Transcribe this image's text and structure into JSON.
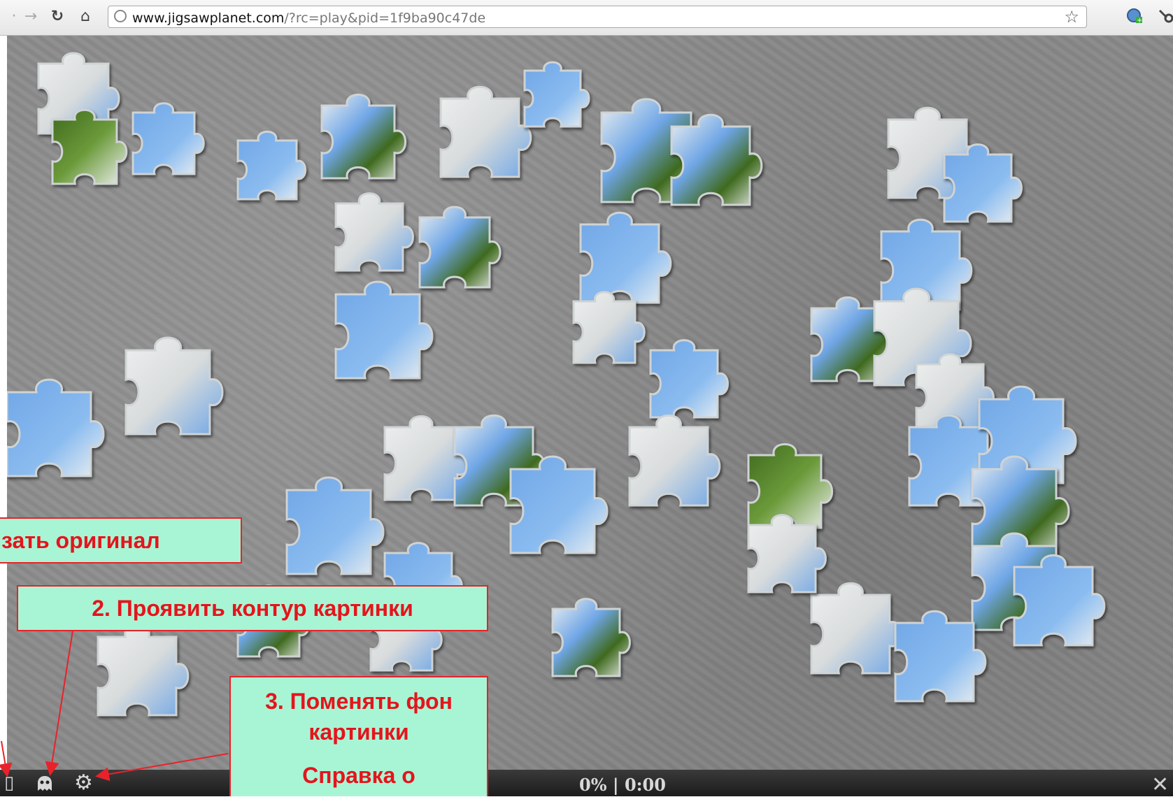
{
  "browser": {
    "url_domain": "www.jigsawplanet.com",
    "url_path": "/?rc=play&pid=1f9ba90c47de",
    "back_icon": "back-arrow-icon",
    "forward_icon": "forward-arrow-icon",
    "reload_icon": "reload-icon",
    "home_icon": "home-icon",
    "bookmark_icon": "star-icon"
  },
  "game": {
    "progress_text": "0% | 0:00",
    "progress_percent": 0,
    "elapsed": "0:00"
  },
  "callouts": {
    "show_original": "зать оригинал",
    "show_outline": "2. Проявить контур картинки",
    "change_bg_line1": "3. Поменять фон",
    "change_bg_line2": "картинки",
    "help_line": "Справка о"
  },
  "colors": {
    "callout_bg": "#a8f5d5",
    "callout_text": "#e5141c",
    "callout_border": "#e8222a",
    "piece_blue": "#6fa6e6",
    "piece_white": "#eef0f0",
    "piece_green": "#3f6a1e"
  }
}
